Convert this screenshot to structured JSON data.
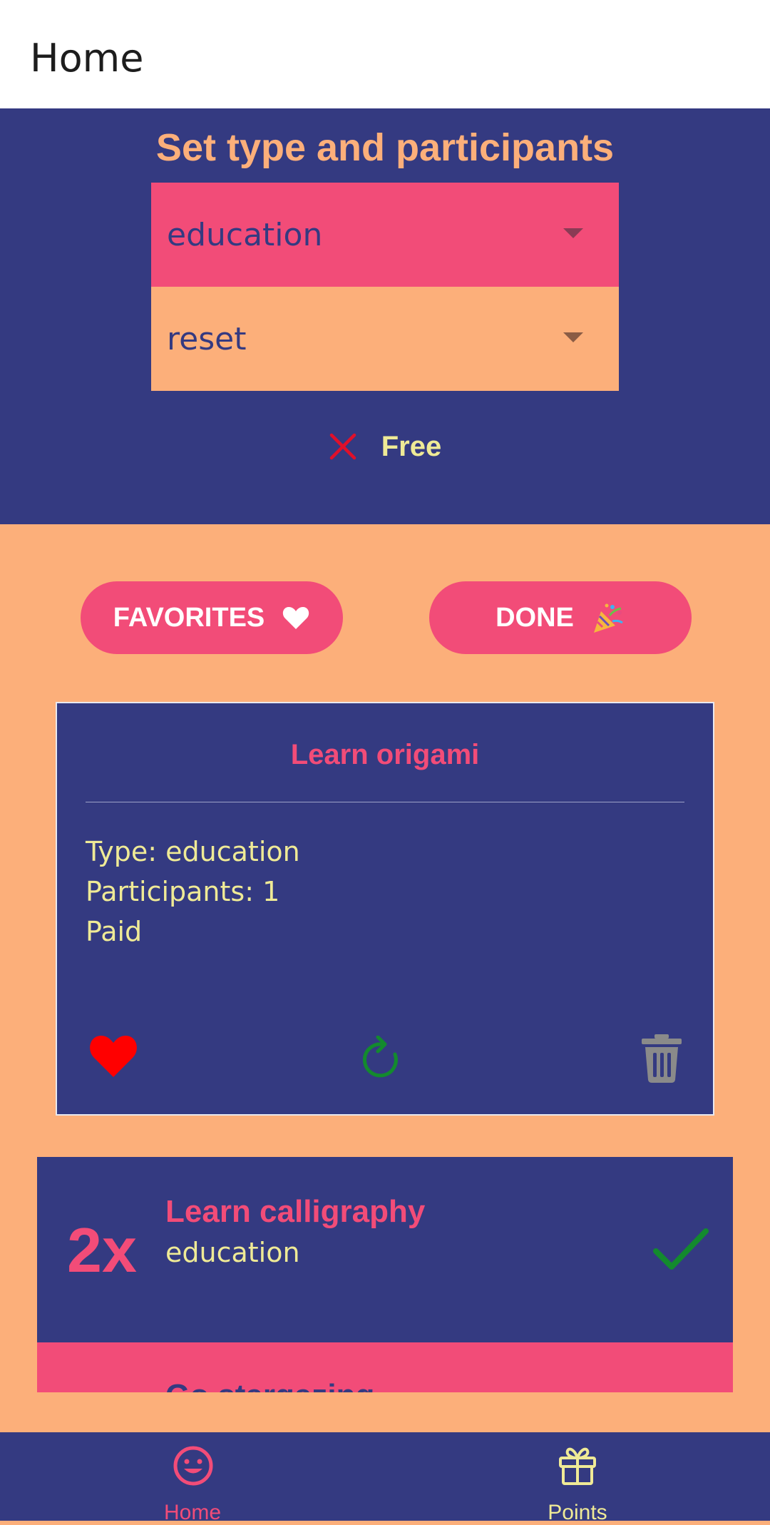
{
  "appbar": {
    "title": "Home"
  },
  "filters": {
    "heading": "Set type and participants",
    "type_select": {
      "value": "education"
    },
    "participants_select": {
      "value": "reset"
    },
    "free_label": "Free"
  },
  "buttons": {
    "favorites": "FAVORITES",
    "done": "DONE"
  },
  "activity_card": {
    "title": "Learn origami",
    "type_line": "Type: education",
    "participants_line": "Participants: 1",
    "price_line": "Paid"
  },
  "done_list": [
    {
      "multiplier": "2x",
      "title": "Learn calligraphy",
      "type": "education"
    },
    {
      "title": "Go stargazing"
    }
  ],
  "bottom_nav": {
    "home": "Home",
    "points": "Points"
  },
  "colors": {
    "navy": "#343A81",
    "pink": "#F24C78",
    "peach": "#FCAF7A",
    "yellow": "#EFEA96",
    "green": "#138A2E",
    "red": "#FF0000"
  }
}
